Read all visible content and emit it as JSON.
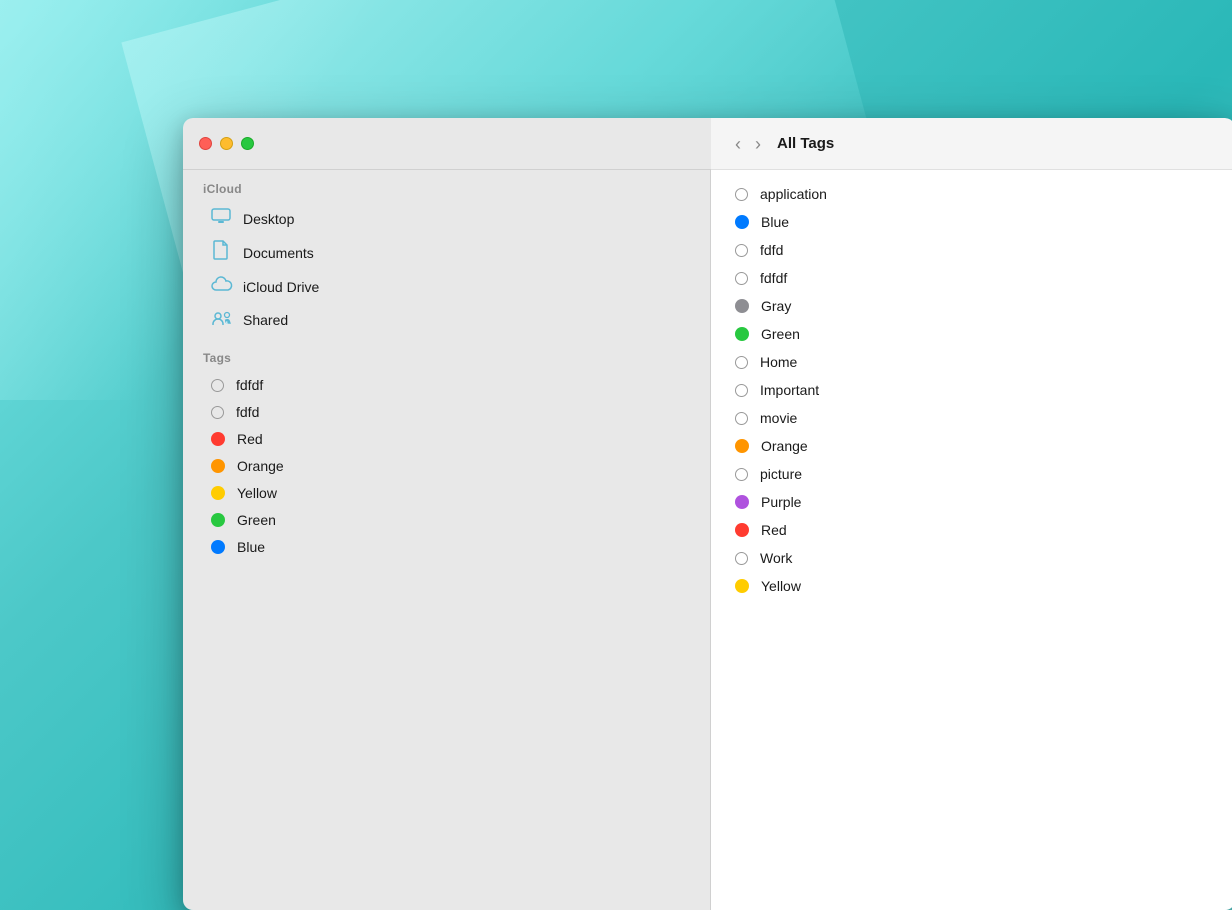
{
  "window": {
    "title": "All Tags",
    "traffic_lights": {
      "close": "close",
      "minimize": "minimize",
      "maximize": "maximize"
    }
  },
  "sidebar": {
    "icloud_label": "iCloud",
    "locations": [
      {
        "id": "desktop",
        "label": "Desktop",
        "icon": "desktop"
      },
      {
        "id": "documents",
        "label": "Documents",
        "icon": "doc"
      },
      {
        "id": "icloud-drive",
        "label": "iCloud Drive",
        "icon": "cloud"
      },
      {
        "id": "shared",
        "label": "Shared",
        "icon": "folder-badge"
      }
    ],
    "tags_label": "Tags",
    "tags": [
      {
        "id": "fdfdf",
        "label": "fdfdf",
        "color": null
      },
      {
        "id": "fdfd",
        "label": "fdfd",
        "color": null
      },
      {
        "id": "red",
        "label": "Red",
        "color": "#ff3b30"
      },
      {
        "id": "orange",
        "label": "Orange",
        "color": "#ff9500"
      },
      {
        "id": "yellow",
        "label": "Yellow",
        "color": "#ffcc00"
      },
      {
        "id": "green",
        "label": "Green",
        "color": "#28c840"
      },
      {
        "id": "blue",
        "label": "Blue",
        "color": "#007aff"
      }
    ]
  },
  "main": {
    "tags": [
      {
        "id": "application",
        "label": "application",
        "color": null
      },
      {
        "id": "blue",
        "label": "Blue",
        "color": "#007aff"
      },
      {
        "id": "fdfd",
        "label": "fdfd",
        "color": null
      },
      {
        "id": "fdfdf",
        "label": "fdfdf",
        "color": null
      },
      {
        "id": "gray",
        "label": "Gray",
        "color": "#8e8e93"
      },
      {
        "id": "green",
        "label": "Green",
        "color": "#28c840"
      },
      {
        "id": "home",
        "label": "Home",
        "color": null
      },
      {
        "id": "important",
        "label": "Important",
        "color": null
      },
      {
        "id": "movie",
        "label": "movie",
        "color": null
      },
      {
        "id": "orange",
        "label": "Orange",
        "color": "#ff9500"
      },
      {
        "id": "picture",
        "label": "picture",
        "color": null
      },
      {
        "id": "purple",
        "label": "Purple",
        "color": "#af52de"
      },
      {
        "id": "red",
        "label": "Red",
        "color": "#ff3b30"
      },
      {
        "id": "work",
        "label": "Work",
        "color": null
      },
      {
        "id": "yellow",
        "label": "Yellow",
        "color": "#ffcc00"
      }
    ]
  },
  "nav": {
    "back_label": "‹",
    "forward_label": "›"
  }
}
